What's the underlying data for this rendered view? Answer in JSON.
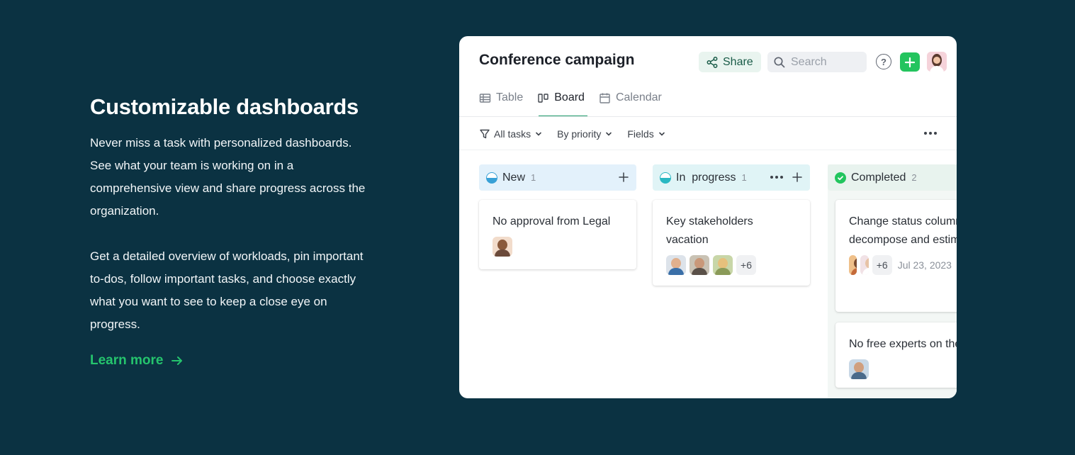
{
  "hero": {
    "heading": "Customizable dashboards",
    "paragraph1": "Never miss a task with personalized dashboards. See what your team is working on in a comprehensive view and share progress across the organization.",
    "paragraph2": "Get a detailed overview of workloads, pin important to-dos, follow important tasks, and choose exactly what you want to see to keep a close eye on progress.",
    "link_label": "Learn more",
    "link_color": "#25c46d",
    "link_icon": "arrow-right-icon"
  },
  "app": {
    "title": "Conference campaign",
    "share_label": "Share",
    "search_placeholder": "Search",
    "help_label": "?",
    "tabs": [
      {
        "label": "Table",
        "icon": "table-icon",
        "active": false
      },
      {
        "label": "Board",
        "icon": "board-icon",
        "active": true
      },
      {
        "label": "Calendar",
        "icon": "calendar-icon",
        "active": false
      }
    ],
    "filters": [
      {
        "label": "All tasks",
        "icon": "funnel-icon"
      },
      {
        "label": "By priority"
      },
      {
        "label": "Fields"
      }
    ],
    "columns": [
      {
        "name": "New",
        "count": "1",
        "color": "#e3f1fb",
        "tasks": [
          {
            "title": "No approval from Legal",
            "more": "",
            "date": ""
          }
        ]
      },
      {
        "name": "In  progress",
        "count": "1",
        "color": "#e0f4f6",
        "tasks": [
          {
            "title": "Key stakeholders vacation",
            "more": "+6",
            "date": ""
          }
        ]
      },
      {
        "name": "Completed",
        "count": "2",
        "color": "#e8f3ee",
        "tasks": [
          {
            "title": "Change status column - decompose and estimate",
            "more": "+6",
            "date": "Jul 23, 2023"
          },
          {
            "title": "No free experts on the",
            "more": "",
            "date": ""
          }
        ]
      }
    ]
  }
}
